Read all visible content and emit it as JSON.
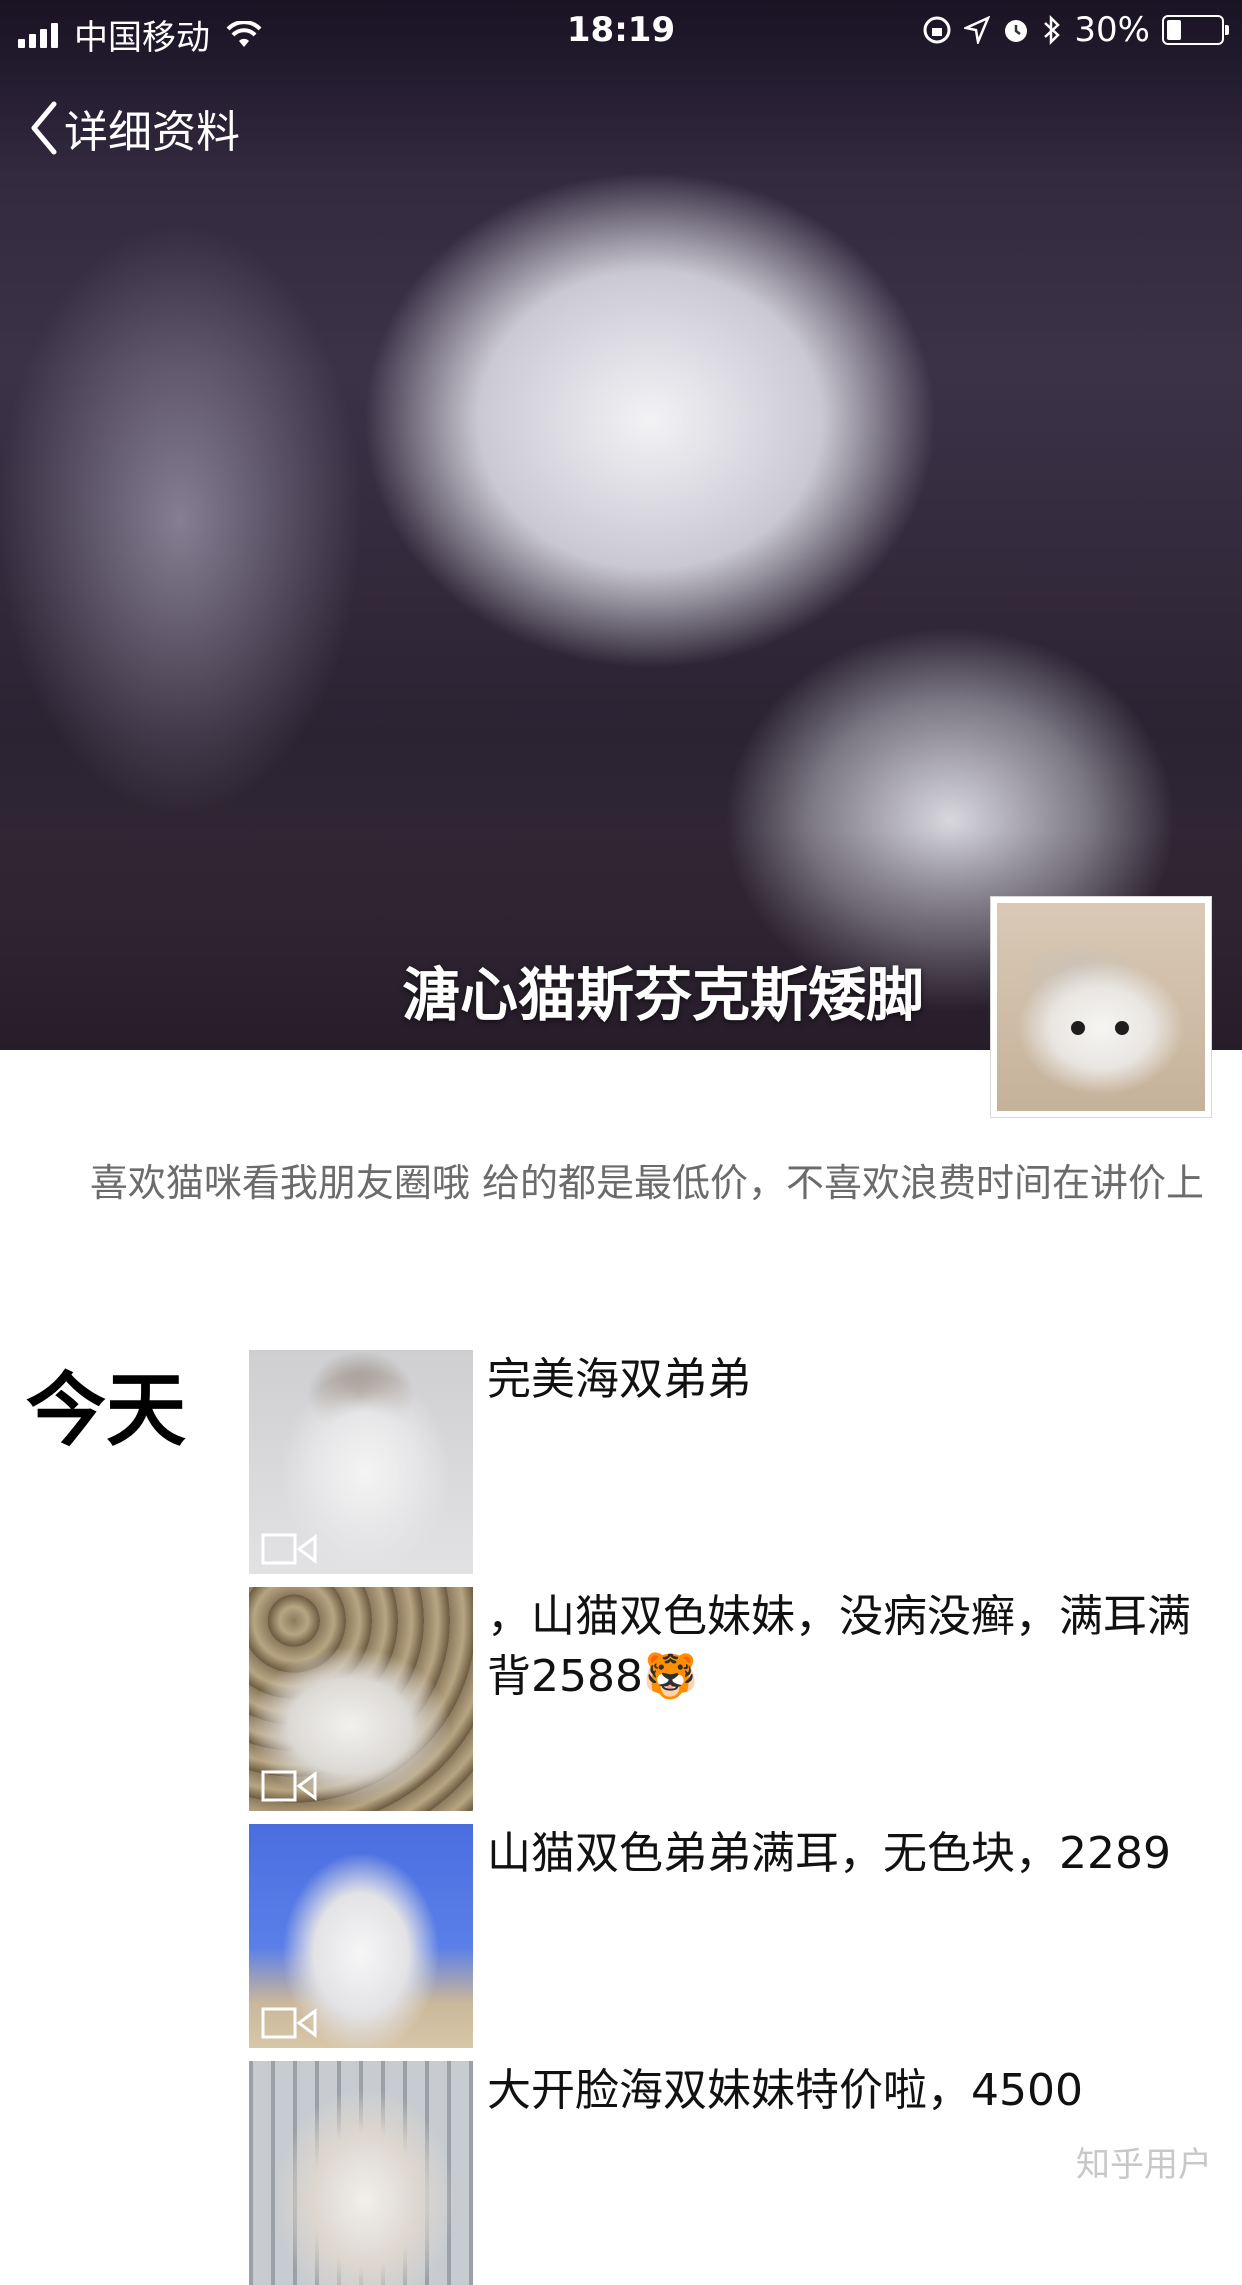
{
  "status_bar": {
    "carrier": "中国移动",
    "time": "18:19",
    "battery_percent_label": "30%",
    "battery_level": 0.3
  },
  "nav": {
    "back_label": "详细资料"
  },
  "profile": {
    "name": "溏心猫斯芬克斯矮脚",
    "signature": "喜欢猫咪看我朋友圈哦 给的都是最低价，不喜欢浪费时间在讲价上"
  },
  "timeline": {
    "day_label": "今天",
    "posts": [
      {
        "text": "完美海双弟弟",
        "media": "video"
      },
      {
        "text": "，山猫双色妹妹，没病没癣，满耳满背2588🐯",
        "media": "video"
      },
      {
        "text": "山猫双色弟弟满耳，无色块，2289",
        "media": "video"
      },
      {
        "text": "大开脸海双妹妹特价啦，4500",
        "media": "image"
      }
    ]
  },
  "watermark": "知乎用户"
}
